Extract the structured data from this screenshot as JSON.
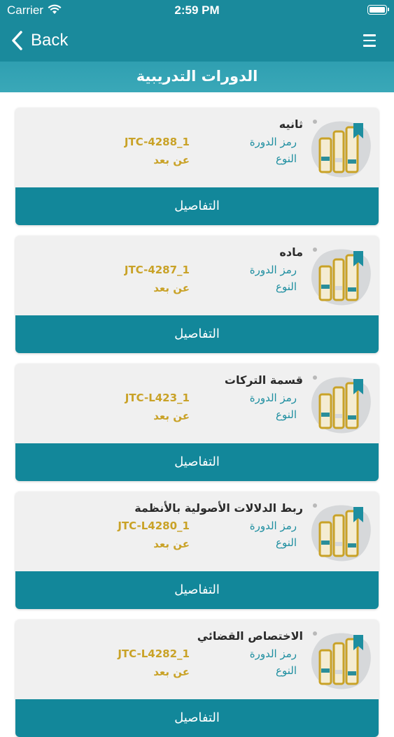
{
  "status_bar": {
    "carrier": "Carrier",
    "time": "2:59 PM"
  },
  "nav": {
    "back_label": "Back"
  },
  "page_title": "الدورات التدريبية",
  "colors": {
    "primary": "#1a8a9c",
    "button": "#12879a",
    "label": "#1d8ea0",
    "value": "#c9a227"
  },
  "labels": {
    "code": "رمز الدورة",
    "type": "النوع",
    "details": "التفاصيل"
  },
  "courses": [
    {
      "title": "ثانيه",
      "code": "JTC-4288_1",
      "type": "عن بعد"
    },
    {
      "title": "ماده",
      "code": "JTC-4287_1",
      "type": "عن بعد"
    },
    {
      "title": "قسمة التركات",
      "code": "JTC-L423_1",
      "type": "عن بعد"
    },
    {
      "title": "ربط الدلالات الأصولية بالأنظمة",
      "code": "JTC-L4280_1",
      "type": "عن بعد"
    },
    {
      "title": "الاختصاص القضائي",
      "code": "JTC-L4282_1",
      "type": "عن بعد"
    }
  ]
}
